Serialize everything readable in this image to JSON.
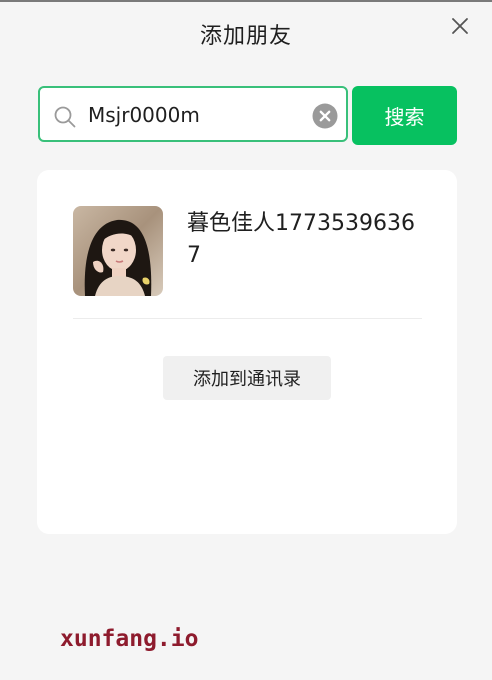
{
  "dialog": {
    "title": "添加朋友",
    "close_icon": "close-icon"
  },
  "search": {
    "value": "Msjr0000m",
    "search_icon": "search-icon",
    "clear_icon": "clear-circle-icon",
    "button_label": "搜索"
  },
  "result": {
    "name": "暮色佳人17735396367",
    "add_button_label": "添加到通讯录"
  },
  "watermark": {
    "text": "xunfang.io"
  },
  "colors": {
    "accent": "#07c160",
    "input_border": "#39c07a",
    "background": "#f5f5f5",
    "card": "#ffffff",
    "watermark": "#8e1b2d"
  }
}
